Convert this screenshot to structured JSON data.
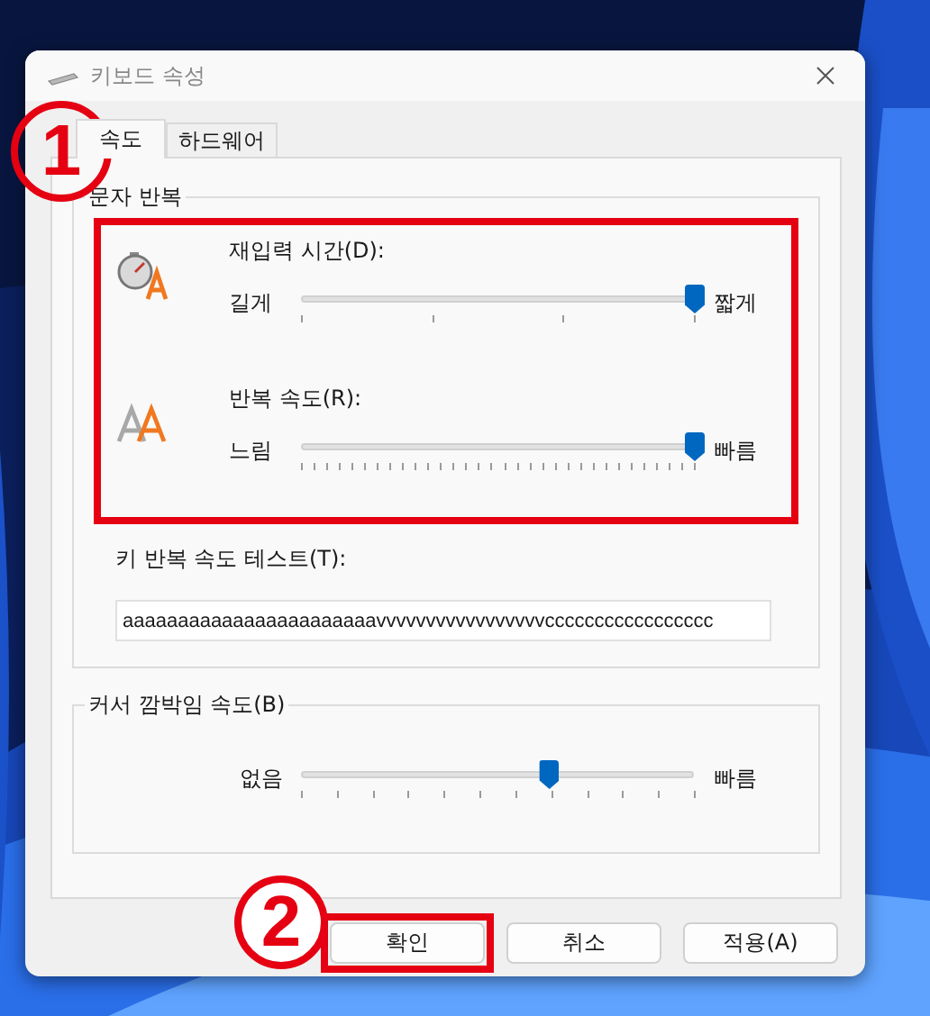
{
  "window": {
    "title": "키보드 속성"
  },
  "tabs": [
    {
      "label": "속도",
      "selected": true
    },
    {
      "label": "하드웨어",
      "selected": false
    }
  ],
  "character_repeat": {
    "title": "문자 반복",
    "highlighted": true,
    "sliders": [
      {
        "label": "재입력 시간(D):",
        "min_label": "길게",
        "max_label": "짧게",
        "level": 1.0
      },
      {
        "label": "반복 속도(R):",
        "min_label": "느림",
        "max_label": "빠름",
        "level": 1.0
      }
    ],
    "test_label": "키 반복 속도 테스트(T):",
    "test_value": "aaaaaaaaaaaaaaaaaaaaaaavvvvvvvvvvvvvvvvvccccccccccccccccc"
  },
  "cursor_blink": {
    "title": "커서 깜박임 속도(B)",
    "min_label": "없음",
    "max_label": "빠름",
    "level": 0.63
  },
  "buttons": [
    {
      "label": "확인",
      "highlighted": true
    },
    {
      "label": "취소",
      "highlighted": false
    },
    {
      "label": "적용(A)",
      "highlighted": false
    }
  ],
  "annotations": [
    {
      "label": "1"
    },
    {
      "label": "2"
    }
  ]
}
